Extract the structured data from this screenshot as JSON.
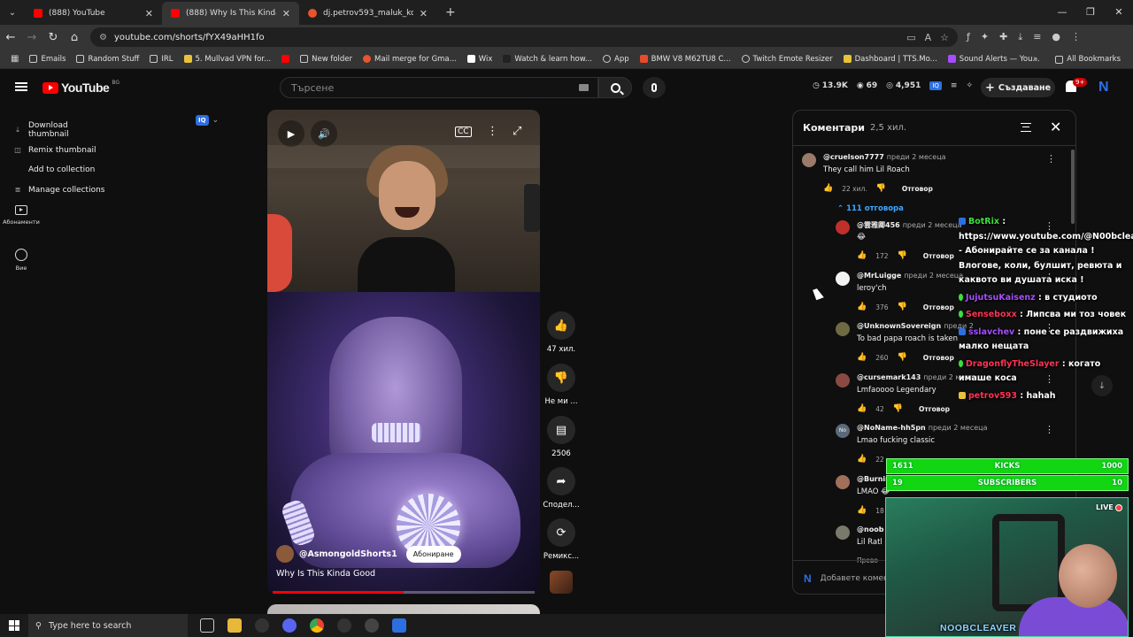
{
  "browser": {
    "tabs": [
      {
        "label": "(888) YouTube",
        "icon": "youtube-favicon",
        "active": false
      },
      {
        "label": "(888) Why Is This Kinda Good -",
        "icon": "youtube-favicon",
        "active": true
      },
      {
        "label": "dj.petrov593_maluk_kor_pimi |",
        "icon": "globe-favicon",
        "active": false
      }
    ],
    "url": "youtube.com/shorts/fYX49aHH1fo",
    "bookmarks": [
      "Emails",
      "Random Stuff",
      "IRL",
      "5. Mullvad VPN for...",
      "New folder",
      "Mail merge for Gma...",
      "Wix",
      "Watch & learn how...",
      "App",
      "BMW V8 M62TU8 C...",
      "Twitch Emote Resizer",
      "Dashboard | TTS.Mo...",
      "Sound Alerts — You..."
    ],
    "all_bookmarks": "All Bookmarks"
  },
  "header": {
    "logo_text": "YouTube",
    "country": "BG",
    "search_placeholder": "Търсене",
    "stats": {
      "views": "13.9K",
      "watching": "69",
      "total": "4,951"
    },
    "create_label": "Създаване",
    "notifications": "9+"
  },
  "left_menu": {
    "items": [
      "Download thumbnail",
      "Remix thumbnail",
      "Add to collection",
      "Manage collections"
    ],
    "iq_label": "IQ",
    "subscriptions_label": "Абонаменти",
    "you_label": "Вие"
  },
  "short": {
    "channel": "@AsmongoldShorts1",
    "subscribe_label": "Абониране",
    "title": "Why Is This Kinda Good",
    "progress_fraction": 0.5
  },
  "actions": {
    "like_count": "47 хил.",
    "dislike_label": "Не ми ...",
    "comments_count": "2506",
    "share_label": "Сподел...",
    "remix_label": "Ремикс..."
  },
  "comments": {
    "title": "Коментари",
    "count": "2,5 хил.",
    "replies_toggle": "111 отговора",
    "reply_label": "Отговор",
    "add_placeholder": "Добавете комент",
    "list": [
      {
        "author": "@cruelson7777",
        "when": "преди 2 месеца",
        "text": "They call him Lil Roach",
        "likes": "22 хил.",
        "reply": true
      },
      {
        "author": "@雲雅卿456",
        "when": "преди 2 месеца",
        "text": "😂",
        "likes": "172",
        "reply": true
      },
      {
        "author": "@MrLuigge",
        "when": "преди 2 месеца",
        "text": "leroy'ch",
        "likes": "376",
        "reply": true
      },
      {
        "author": "@UnknownSovereign",
        "when": "преди 2",
        "text": "To bad papa roach is taken",
        "likes": "260",
        "reply": true
      },
      {
        "author": "@cursemark143",
        "when": "преди 2 месец",
        "text": "Lmfaoooo Legendary",
        "likes": "42",
        "reply": true
      },
      {
        "author": "@NoName-hh5pn",
        "when": "преди 2 месеца",
        "text": "Lmao fucking classic",
        "likes": "22",
        "reply": false
      },
      {
        "author": "@Burnin",
        "when": "",
        "text": "LMAO 😂",
        "likes": "18",
        "reply": false
      },
      {
        "author": "@noob",
        "when": "",
        "text": "Lil Ratl",
        "likes": "",
        "reply": false
      }
    ],
    "cut_text": "Прево"
  },
  "stream_chat": [
    {
      "user": "BotRix",
      "color": "#3be03b",
      "text": "https://www.youtube.com/@N00bcleaver - Абонирайте се за канала ! Влогове, коли, булшит, ревюта и каквото ви душата иска !"
    },
    {
      "user": "JujutsuKaisenz",
      "color": "#a64dff",
      "text": "в студиото"
    },
    {
      "user": "Senseboxx",
      "color": "#ff3355",
      "text": "Липсва ми тоз човек"
    },
    {
      "user": "sslavchev",
      "color": "#a64dff",
      "text": "поне се раздвижиха малко нещата"
    },
    {
      "user": "DragonflyTheSlayer",
      "color": "#ff3355",
      "text": "когато имаше коса"
    },
    {
      "user": "petrov593",
      "color": "#ff3355",
      "text": "hahah"
    }
  ],
  "goals": [
    {
      "left": "1611",
      "label": "KICKS",
      "right": "1000"
    },
    {
      "left": "19",
      "label": "SUBSCRIBERS",
      "right": "10"
    }
  ],
  "webcam": {
    "live_label": "LIVE",
    "name": "NOOBCLEAVER"
  },
  "taskbar": {
    "search_placeholder": "Type here to search"
  },
  "colors": {
    "accent_red": "#ff0000",
    "link_blue": "#3ea6ff",
    "goal_green": "#11d611"
  }
}
